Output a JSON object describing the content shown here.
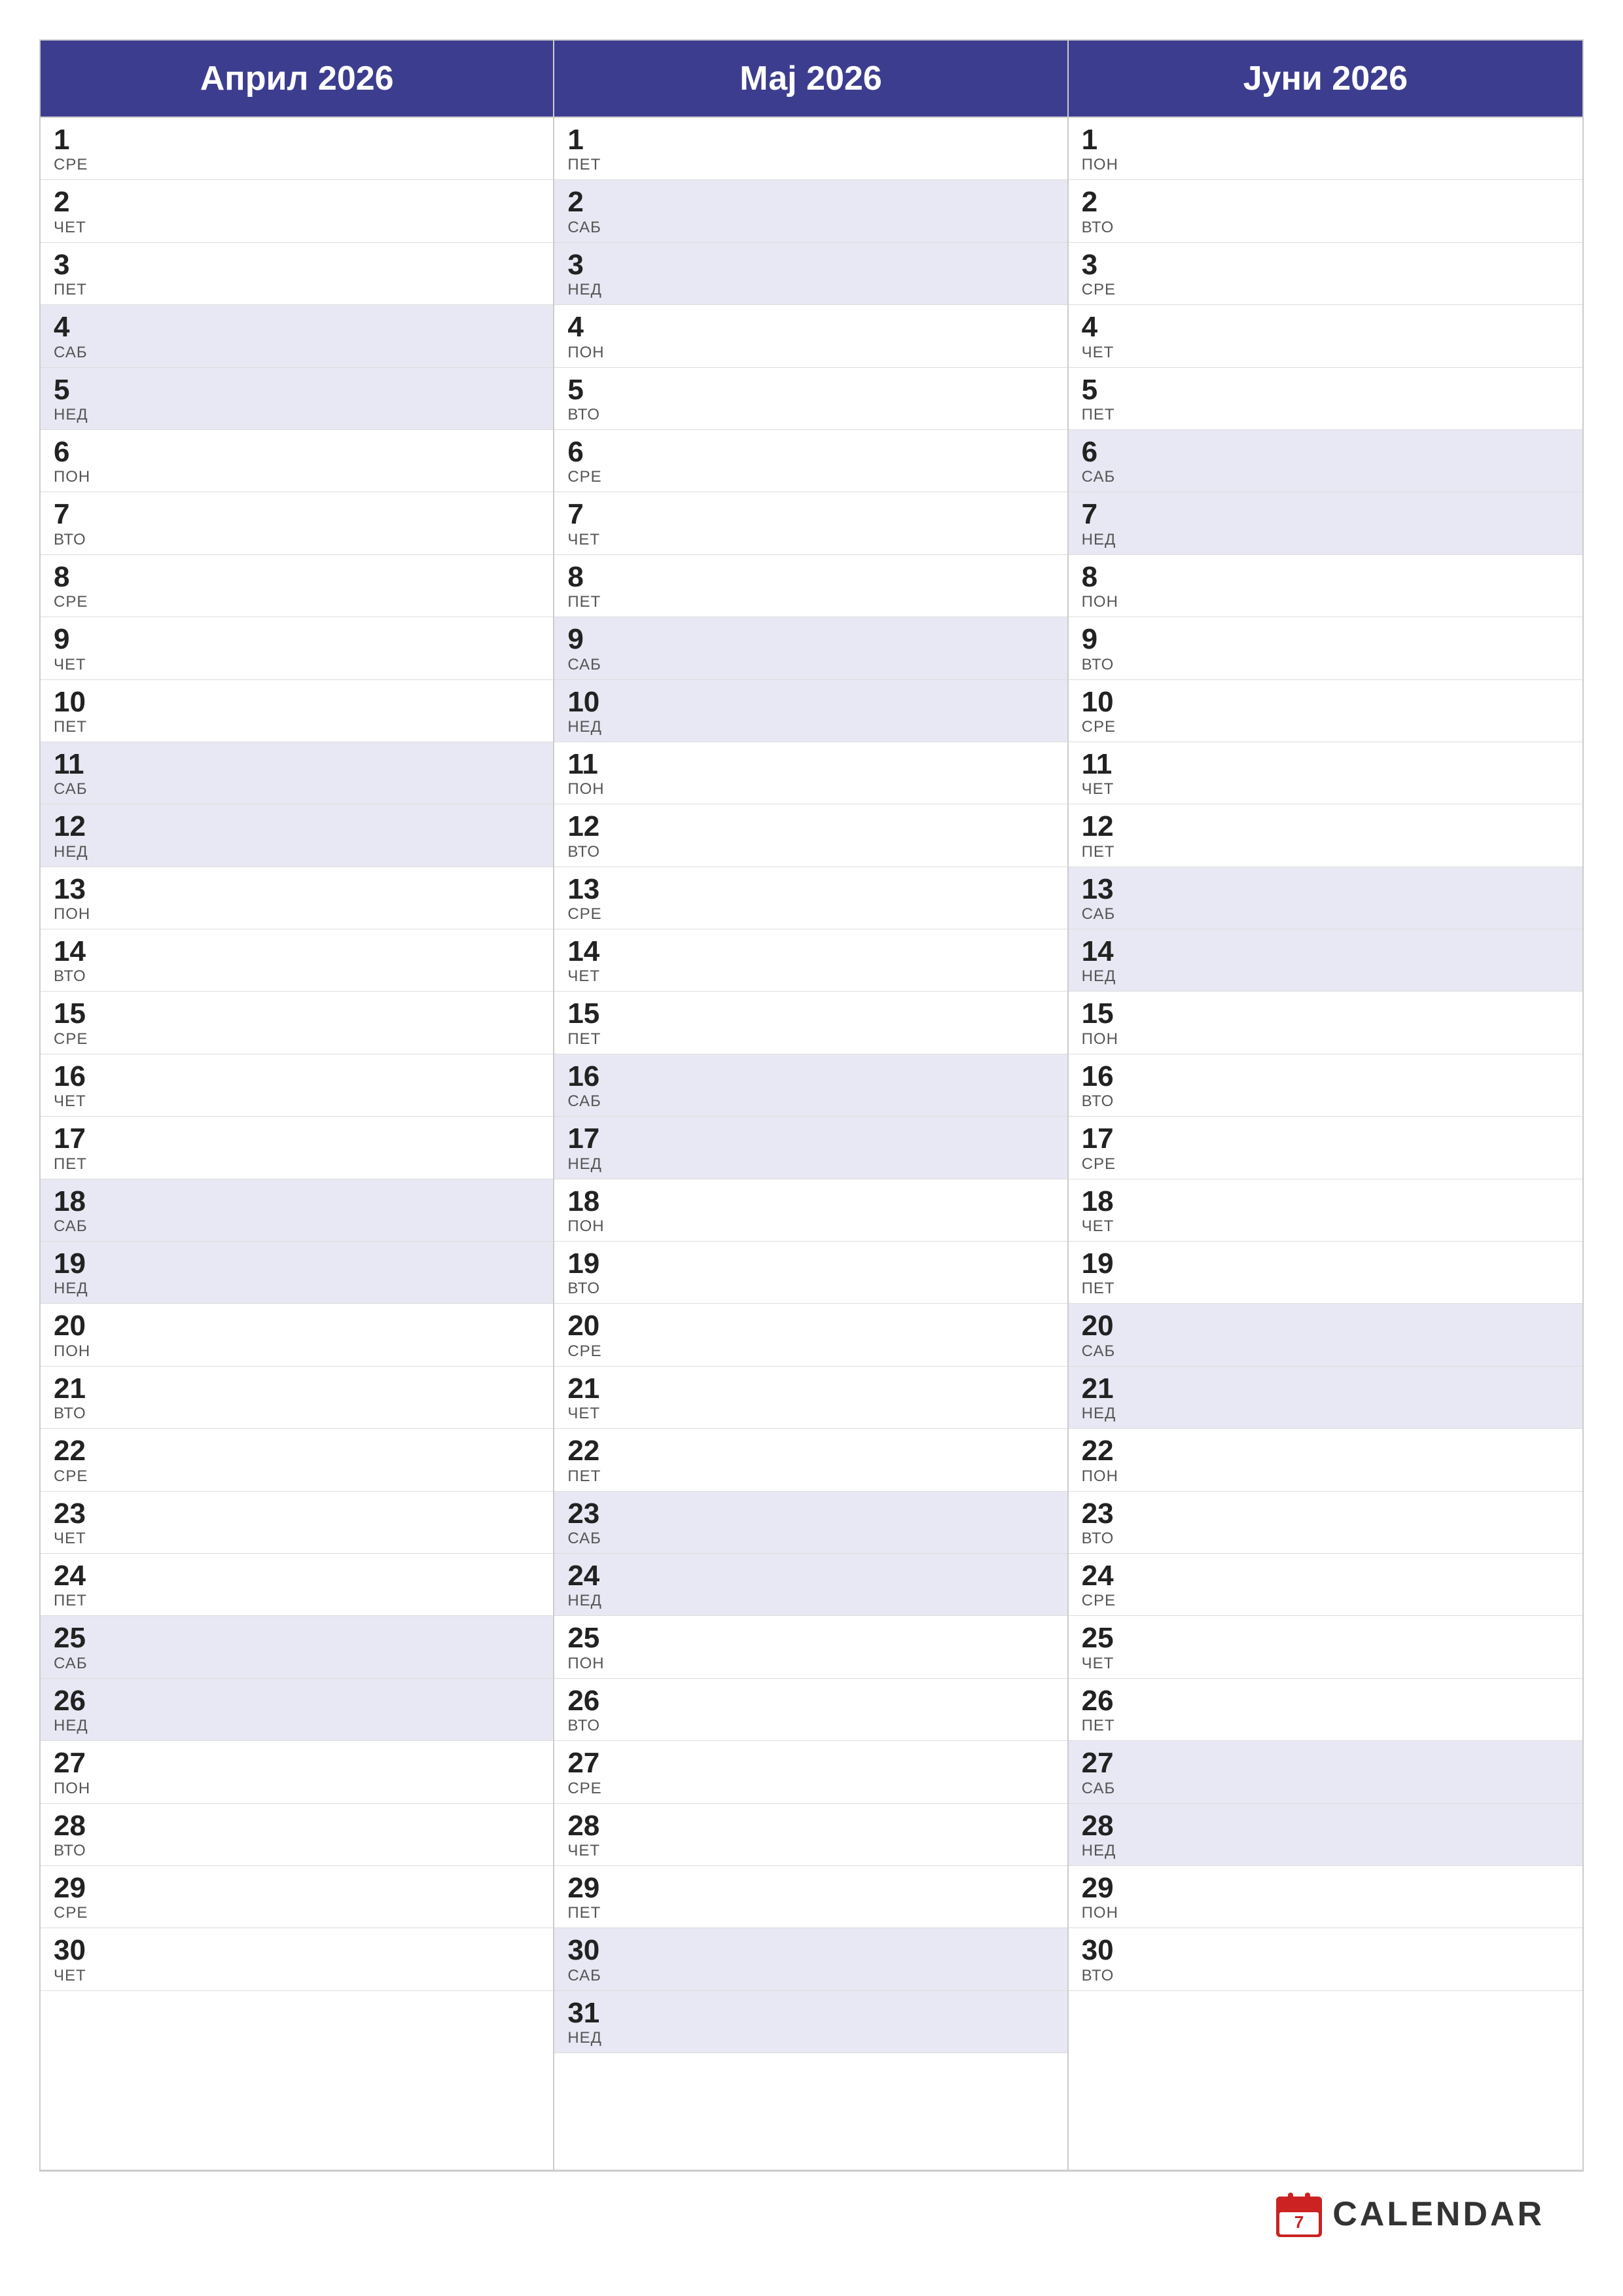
{
  "months": [
    {
      "name": "Април 2026",
      "days": [
        {
          "num": "1",
          "name": "СРЕ",
          "weekend": false
        },
        {
          "num": "2",
          "name": "ЧЕТ",
          "weekend": false
        },
        {
          "num": "3",
          "name": "ПЕТ",
          "weekend": false
        },
        {
          "num": "4",
          "name": "САБ",
          "weekend": true
        },
        {
          "num": "5",
          "name": "НЕД",
          "weekend": true
        },
        {
          "num": "6",
          "name": "ПОН",
          "weekend": false
        },
        {
          "num": "7",
          "name": "ВТО",
          "weekend": false
        },
        {
          "num": "8",
          "name": "СРЕ",
          "weekend": false
        },
        {
          "num": "9",
          "name": "ЧЕТ",
          "weekend": false
        },
        {
          "num": "10",
          "name": "ПЕТ",
          "weekend": false
        },
        {
          "num": "11",
          "name": "САБ",
          "weekend": true
        },
        {
          "num": "12",
          "name": "НЕД",
          "weekend": true
        },
        {
          "num": "13",
          "name": "ПОН",
          "weekend": false
        },
        {
          "num": "14",
          "name": "ВТО",
          "weekend": false
        },
        {
          "num": "15",
          "name": "СРЕ",
          "weekend": false
        },
        {
          "num": "16",
          "name": "ЧЕТ",
          "weekend": false
        },
        {
          "num": "17",
          "name": "ПЕТ",
          "weekend": false
        },
        {
          "num": "18",
          "name": "САБ",
          "weekend": true
        },
        {
          "num": "19",
          "name": "НЕД",
          "weekend": true
        },
        {
          "num": "20",
          "name": "ПОН",
          "weekend": false
        },
        {
          "num": "21",
          "name": "ВТО",
          "weekend": false
        },
        {
          "num": "22",
          "name": "СРЕ",
          "weekend": false
        },
        {
          "num": "23",
          "name": "ЧЕТ",
          "weekend": false
        },
        {
          "num": "24",
          "name": "ПЕТ",
          "weekend": false
        },
        {
          "num": "25",
          "name": "САБ",
          "weekend": true
        },
        {
          "num": "26",
          "name": "НЕД",
          "weekend": true
        },
        {
          "num": "27",
          "name": "ПОН",
          "weekend": false
        },
        {
          "num": "28",
          "name": "ВТО",
          "weekend": false
        },
        {
          "num": "29",
          "name": "СРЕ",
          "weekend": false
        },
        {
          "num": "30",
          "name": "ЧЕТ",
          "weekend": false
        }
      ]
    },
    {
      "name": "Мај 2026",
      "days": [
        {
          "num": "1",
          "name": "ПЕТ",
          "weekend": false
        },
        {
          "num": "2",
          "name": "САБ",
          "weekend": true
        },
        {
          "num": "3",
          "name": "НЕД",
          "weekend": true
        },
        {
          "num": "4",
          "name": "ПОН",
          "weekend": false
        },
        {
          "num": "5",
          "name": "ВТО",
          "weekend": false
        },
        {
          "num": "6",
          "name": "СРЕ",
          "weekend": false
        },
        {
          "num": "7",
          "name": "ЧЕТ",
          "weekend": false
        },
        {
          "num": "8",
          "name": "ПЕТ",
          "weekend": false
        },
        {
          "num": "9",
          "name": "САБ",
          "weekend": true
        },
        {
          "num": "10",
          "name": "НЕД",
          "weekend": true
        },
        {
          "num": "11",
          "name": "ПОН",
          "weekend": false
        },
        {
          "num": "12",
          "name": "ВТО",
          "weekend": false
        },
        {
          "num": "13",
          "name": "СРЕ",
          "weekend": false
        },
        {
          "num": "14",
          "name": "ЧЕТ",
          "weekend": false
        },
        {
          "num": "15",
          "name": "ПЕТ",
          "weekend": false
        },
        {
          "num": "16",
          "name": "САБ",
          "weekend": true
        },
        {
          "num": "17",
          "name": "НЕД",
          "weekend": true
        },
        {
          "num": "18",
          "name": "ПОН",
          "weekend": false
        },
        {
          "num": "19",
          "name": "ВТО",
          "weekend": false
        },
        {
          "num": "20",
          "name": "СРЕ",
          "weekend": false
        },
        {
          "num": "21",
          "name": "ЧЕТ",
          "weekend": false
        },
        {
          "num": "22",
          "name": "ПЕТ",
          "weekend": false
        },
        {
          "num": "23",
          "name": "САБ",
          "weekend": true
        },
        {
          "num": "24",
          "name": "НЕД",
          "weekend": true
        },
        {
          "num": "25",
          "name": "ПОН",
          "weekend": false
        },
        {
          "num": "26",
          "name": "ВТО",
          "weekend": false
        },
        {
          "num": "27",
          "name": "СРЕ",
          "weekend": false
        },
        {
          "num": "28",
          "name": "ЧЕТ",
          "weekend": false
        },
        {
          "num": "29",
          "name": "ПЕТ",
          "weekend": false
        },
        {
          "num": "30",
          "name": "САБ",
          "weekend": true
        },
        {
          "num": "31",
          "name": "НЕД",
          "weekend": true
        }
      ]
    },
    {
      "name": "Јуни 2026",
      "days": [
        {
          "num": "1",
          "name": "ПОН",
          "weekend": false
        },
        {
          "num": "2",
          "name": "ВТО",
          "weekend": false
        },
        {
          "num": "3",
          "name": "СРЕ",
          "weekend": false
        },
        {
          "num": "4",
          "name": "ЧЕТ",
          "weekend": false
        },
        {
          "num": "5",
          "name": "ПЕТ",
          "weekend": false
        },
        {
          "num": "6",
          "name": "САБ",
          "weekend": true
        },
        {
          "num": "7",
          "name": "НЕД",
          "weekend": true
        },
        {
          "num": "8",
          "name": "ПОН",
          "weekend": false
        },
        {
          "num": "9",
          "name": "ВТО",
          "weekend": false
        },
        {
          "num": "10",
          "name": "СРЕ",
          "weekend": false
        },
        {
          "num": "11",
          "name": "ЧЕТ",
          "weekend": false
        },
        {
          "num": "12",
          "name": "ПЕТ",
          "weekend": false
        },
        {
          "num": "13",
          "name": "САБ",
          "weekend": true
        },
        {
          "num": "14",
          "name": "НЕД",
          "weekend": true
        },
        {
          "num": "15",
          "name": "ПОН",
          "weekend": false
        },
        {
          "num": "16",
          "name": "ВТО",
          "weekend": false
        },
        {
          "num": "17",
          "name": "СРЕ",
          "weekend": false
        },
        {
          "num": "18",
          "name": "ЧЕТ",
          "weekend": false
        },
        {
          "num": "19",
          "name": "ПЕТ",
          "weekend": false
        },
        {
          "num": "20",
          "name": "САБ",
          "weekend": true
        },
        {
          "num": "21",
          "name": "НЕД",
          "weekend": true
        },
        {
          "num": "22",
          "name": "ПОН",
          "weekend": false
        },
        {
          "num": "23",
          "name": "ВТО",
          "weekend": false
        },
        {
          "num": "24",
          "name": "СРЕ",
          "weekend": false
        },
        {
          "num": "25",
          "name": "ЧЕТ",
          "weekend": false
        },
        {
          "num": "26",
          "name": "ПЕТ",
          "weekend": false
        },
        {
          "num": "27",
          "name": "САБ",
          "weekend": true
        },
        {
          "num": "28",
          "name": "НЕД",
          "weekend": true
        },
        {
          "num": "29",
          "name": "ПОН",
          "weekend": false
        },
        {
          "num": "30",
          "name": "ВТО",
          "weekend": false
        }
      ]
    }
  ],
  "footer": {
    "logo_text": "CALENDAR"
  }
}
